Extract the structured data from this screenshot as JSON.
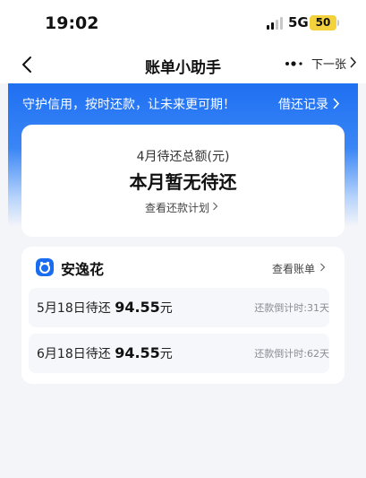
{
  "status_bar": {
    "time": "19:02",
    "network": "5G",
    "battery": "50",
    "battery_color": "#f3d23d"
  },
  "navbar": {
    "back_icon": "chevron-left-icon",
    "title": "账单小助手",
    "more_icon": "more-dots-icon",
    "next_label": "下一张"
  },
  "banner": {
    "text": "守护信用，按时还款，让未来更可期！",
    "link": "借还记录",
    "color": "#1f6ff2"
  },
  "summary": {
    "label": "4月待还总额(元)",
    "value": "本月暂无待还",
    "plan_link": "查看还款计划"
  },
  "product": {
    "logo_icon": "product-logo-icon",
    "logo_color": "#1a6cf0",
    "name": "安逸花",
    "bill_link": "查看账单",
    "installments": [
      {
        "date_text": "5月18日待还",
        "amount": "94.55",
        "unit": "元",
        "countdown": "还款倒计时:31天"
      },
      {
        "date_text": "6月18日待还",
        "amount": "94.55",
        "unit": "元",
        "countdown": "还款倒计时:62天"
      }
    ]
  }
}
